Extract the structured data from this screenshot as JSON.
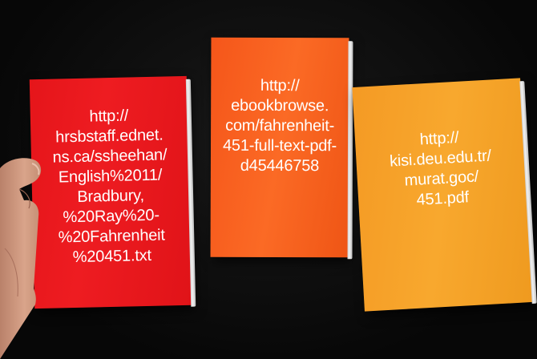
{
  "books": [
    {
      "color": "#ee1c21",
      "url_lines": [
        "http://",
        "hrsbstaff.ednet.",
        "ns.ca/ssheehan/",
        "English%2011/",
        "Bradbury,",
        "%20Ray%20-",
        "%20Fahrenheit",
        "%20451.txt"
      ]
    },
    {
      "color": "#fb6a25",
      "url_lines": [
        "http://",
        "ebookbrowse.",
        "com/fahrenheit-",
        "451-full-text-pdf-",
        "d45446758"
      ]
    },
    {
      "color": "#f8a82e",
      "url_lines": [
        "http://",
        "kisi.deu.edu.tr/",
        "murat.goc/",
        "451.pdf"
      ]
    }
  ]
}
